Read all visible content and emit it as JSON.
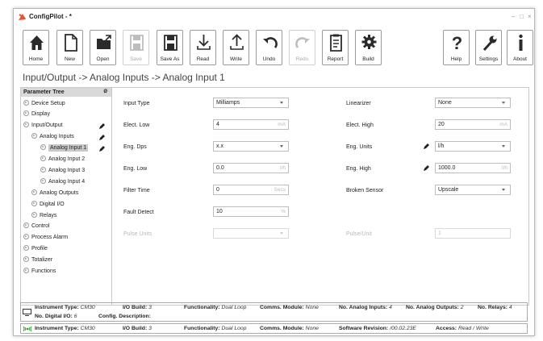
{
  "window": {
    "title": "ConfigPilot - *"
  },
  "toolbar": {
    "home": "Home",
    "new": "New",
    "open": "Open",
    "save": "Save",
    "save_as": "Save As",
    "read": "Read",
    "write": "Write",
    "undo": "Undo",
    "redo": "Redo",
    "report": "Report",
    "build": "Build",
    "help": "Help",
    "settings": "Settings",
    "about": "About"
  },
  "breadcrumb": "Input/Output -> Analog Inputs -> Analog Input 1",
  "tree": {
    "header": "Parameter Tree",
    "pin": "Ø",
    "items": [
      "Device Setup",
      "Display",
      "Input/Output",
      "Analog Inputs",
      "Analog Input 1",
      "Analog Input 2",
      "Analog Input 3",
      "Analog Input 4",
      "Analog Outputs",
      "Digital I/O",
      "Relays",
      "Control",
      "Process Alarm",
      "Profile",
      "Totalizer",
      "Functions"
    ]
  },
  "form": {
    "input_type": {
      "label": "Input Type",
      "value": "Milliamps"
    },
    "linearizer": {
      "label": "Linearizer",
      "value": "None"
    },
    "elect_low": {
      "label": "Elect. Low",
      "value": "4",
      "unit": "mA"
    },
    "elect_high": {
      "label": "Elect. High",
      "value": "20",
      "unit": "mA"
    },
    "eng_dps": {
      "label": "Eng. Dps",
      "value": "x.x"
    },
    "eng_units": {
      "label": "Eng. Units",
      "value": "l/h"
    },
    "eng_low": {
      "label": "Eng. Low",
      "value": "0.0",
      "unit": "l/h"
    },
    "eng_high": {
      "label": "Eng. High",
      "value": "1000.0",
      "unit": "l/h"
    },
    "filter_time": {
      "label": "Filter Time",
      "value": "0",
      "unit": "Secs"
    },
    "broken_sensor": {
      "label": "Broken Sensor",
      "value": "Upscale"
    },
    "fault_detect": {
      "label": "Fault Detect",
      "value": "10",
      "unit": "%"
    },
    "pulse_units": {
      "label": "Pulse Units",
      "value": ""
    },
    "pulse_unit": {
      "label": "Pulse/Unit",
      "value": "1"
    }
  },
  "status1": {
    "instrument_type_k": "Instrument Type:",
    "instrument_type_v": "CM30",
    "io_build_k": "I/O Build:",
    "io_build_v": "3",
    "functionality_k": "Functionality:",
    "functionality_v": "Dual Loop",
    "comms_k": "Comms. Module:",
    "comms_v": "None",
    "ai_k": "No. Analog Inputs:",
    "ai_v": "4",
    "ao_k": "No. Analog Outputs:",
    "ao_v": "2",
    "relays_k": "No. Relays:",
    "relays_v": "4",
    "dio_k": "No. Digital I/O:",
    "dio_v": "6",
    "config_k": "Config. Description:"
  },
  "status2": {
    "instrument_type_k": "Instrument Type:",
    "instrument_type_v": "CM30",
    "io_build_k": "I/O Build:",
    "io_build_v": "3",
    "functionality_k": "Functionality:",
    "functionality_v": "Dual Loop",
    "comms_k": "Comms. Module:",
    "comms_v": "None",
    "sw_k": "Software Revision:",
    "sw_v": "/00.02.23E",
    "access_k": "Access:",
    "access_v": "Read / Write"
  },
  "colors": {
    "accent": "#e8542a",
    "connected": "#2aa02a"
  }
}
